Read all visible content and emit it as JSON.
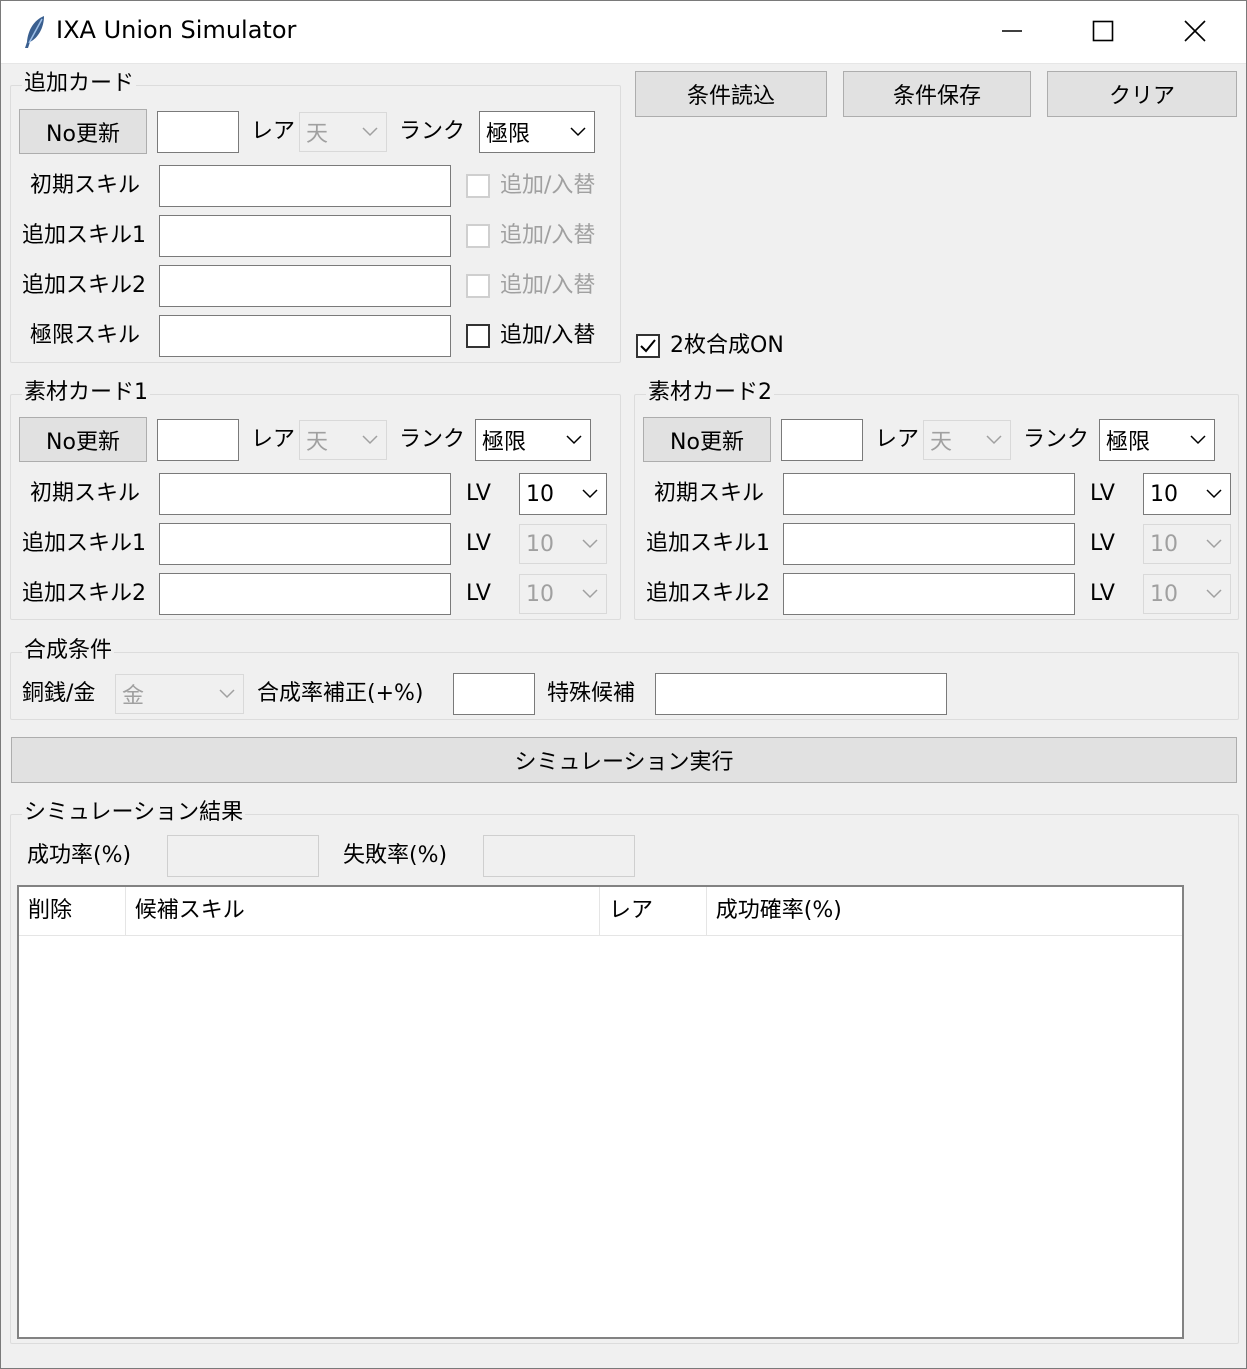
{
  "window": {
    "title": "IXA Union Simulator",
    "icon": "feather-icon",
    "controls": [
      "minimize-icon",
      "maximize-icon",
      "close-icon"
    ]
  },
  "add_card": {
    "legend": "追加カード",
    "no_button": "No更新",
    "no_value": "",
    "rare_label": "レア",
    "rare_value": "天",
    "rank_label": "ランク",
    "rank_value": "極限",
    "rows": [
      {
        "label": "初期スキル",
        "value": "",
        "checkbox_label": "追加/入替",
        "checked": false,
        "enabled": false
      },
      {
        "label": "追加スキル1",
        "value": "",
        "checkbox_label": "追加/入替",
        "checked": false,
        "enabled": false
      },
      {
        "label": "追加スキル2",
        "value": "",
        "checkbox_label": "追加/入替",
        "checked": false,
        "enabled": false
      },
      {
        "label": "極限スキル",
        "value": "",
        "checkbox_label": "追加/入替",
        "checked": false,
        "enabled": true
      }
    ]
  },
  "toolbar": {
    "load_label": "条件読込",
    "save_label": "条件保存",
    "clear_label": "クリア",
    "two_card_label": "2枚合成ON",
    "two_card_checked": true
  },
  "material1": {
    "legend": "素材カード1",
    "no_button": "No更新",
    "no_value": "",
    "rare_label": "レア",
    "rare_value": "天",
    "rank_label": "ランク",
    "rank_value": "極限",
    "rows": [
      {
        "label": "初期スキル",
        "value": "",
        "lv_label": "LV",
        "lv": "10",
        "enabled": true
      },
      {
        "label": "追加スキル1",
        "value": "",
        "lv_label": "LV",
        "lv": "10",
        "enabled": false
      },
      {
        "label": "追加スキル2",
        "value": "",
        "lv_label": "LV",
        "lv": "10",
        "enabled": false
      }
    ]
  },
  "material2": {
    "legend": "素材カード2",
    "no_button": "No更新",
    "no_value": "",
    "rare_label": "レア",
    "rare_value": "天",
    "rank_label": "ランク",
    "rank_value": "極限",
    "rows": [
      {
        "label": "初期スキル",
        "value": "",
        "lv_label": "LV",
        "lv": "10",
        "enabled": true
      },
      {
        "label": "追加スキル1",
        "value": "",
        "lv_label": "LV",
        "lv": "10",
        "enabled": false
      },
      {
        "label": "追加スキル2",
        "value": "",
        "lv_label": "LV",
        "lv": "10",
        "enabled": false
      }
    ]
  },
  "conditions": {
    "legend": "合成条件",
    "money_label": "銅銭/金",
    "money_value": "金",
    "rate_label": "合成率補正(+%)",
    "rate_value": "",
    "special_label": "特殊候補",
    "special_value": ""
  },
  "run_label": "シミュレーション実行",
  "results": {
    "legend": "シミュレーション結果",
    "success_label": "成功率(%)",
    "success_value": "",
    "fail_label": "失敗率(%)",
    "fail_value": "",
    "columns": [
      "削除",
      "候補スキル",
      "レア",
      "成功確率(%)"
    ],
    "rows": []
  }
}
